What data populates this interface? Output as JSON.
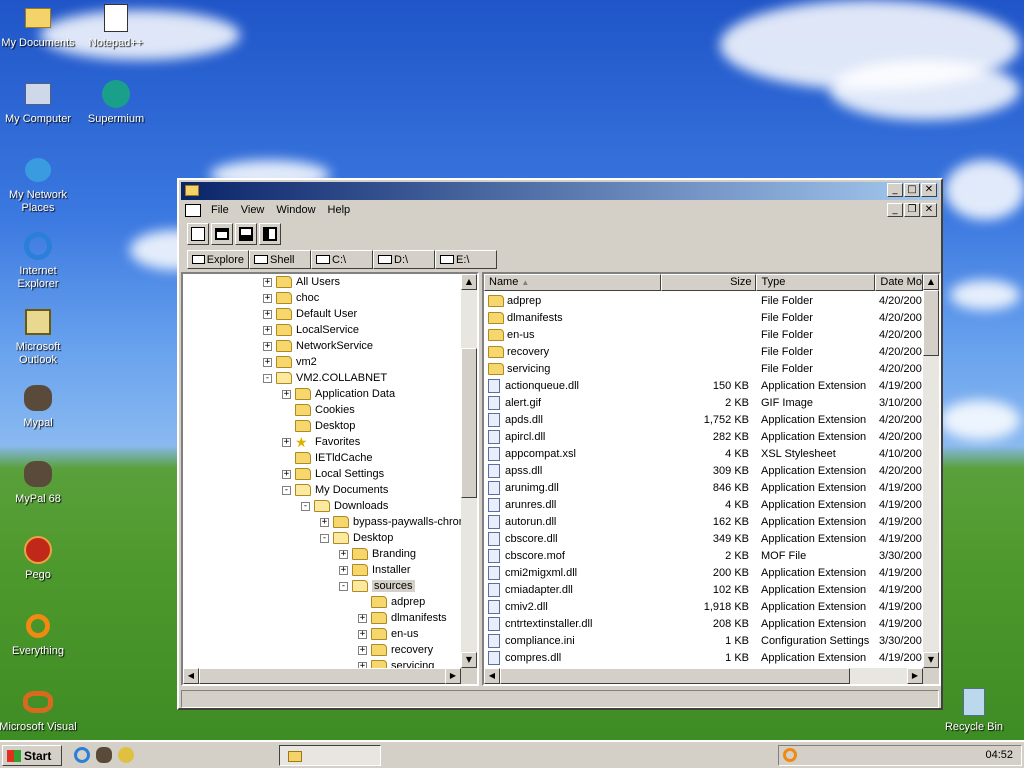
{
  "desktop": {
    "icons": [
      {
        "label": "My Documents"
      },
      {
        "label": "Notepad++"
      },
      {
        "label": "My Computer"
      },
      {
        "label": "Supermium"
      },
      {
        "label": "My Network Places"
      },
      {
        "label": "Internet Explorer"
      },
      {
        "label": "Microsoft Outlook"
      },
      {
        "label": "Mypal"
      },
      {
        "label": "MyPal 68"
      },
      {
        "label": "Pego"
      },
      {
        "label": "Everything"
      },
      {
        "label": "Microsoft Visual"
      },
      {
        "label": "Recycle Bin"
      }
    ]
  },
  "window": {
    "menu": [
      "File",
      "View",
      "Window",
      "Help"
    ],
    "drives": [
      "Explore",
      "Shell",
      "C:\\",
      "D:\\",
      "E:\\"
    ],
    "tree": [
      {
        "label": "All Users",
        "expander": "+"
      },
      {
        "label": "choc",
        "expander": "+"
      },
      {
        "label": "Default User",
        "expander": "+"
      },
      {
        "label": "LocalService",
        "expander": "+"
      },
      {
        "label": "NetworkService",
        "expander": "+"
      },
      {
        "label": "vm2",
        "expander": "+"
      },
      {
        "label": "VM2.COLLABNET",
        "expander": "-"
      },
      {
        "label": "Application Data",
        "expander": "+"
      },
      {
        "label": "Cookies",
        "expander": ""
      },
      {
        "label": "Desktop",
        "expander": ""
      },
      {
        "label": "Favorites",
        "expander": "+"
      },
      {
        "label": "IETldCache",
        "expander": ""
      },
      {
        "label": "Local Settings",
        "expander": "+"
      },
      {
        "label": "My Documents",
        "expander": "-"
      },
      {
        "label": "Downloads",
        "expander": "-"
      },
      {
        "label": "bypass-paywalls-chrom",
        "expander": "+"
      },
      {
        "label": "Desktop",
        "expander": "-"
      },
      {
        "label": "Branding",
        "expander": "+"
      },
      {
        "label": "Installer",
        "expander": "+"
      },
      {
        "label": "sources",
        "expander": "-"
      },
      {
        "label": "adprep",
        "expander": ""
      },
      {
        "label": "dlmanifests",
        "expander": "+"
      },
      {
        "label": "en-us",
        "expander": "+"
      },
      {
        "label": "recovery",
        "expander": "+"
      },
      {
        "label": "servicing",
        "expander": "+"
      }
    ],
    "columns": {
      "name": "Name",
      "size": "Size",
      "type": "Type",
      "date": "Date Mo"
    },
    "files": [
      {
        "name": "adprep",
        "size": "",
        "type": "File Folder",
        "date": "4/20/200",
        "kind": "folder"
      },
      {
        "name": "dlmanifests",
        "size": "",
        "type": "File Folder",
        "date": "4/20/200",
        "kind": "folder"
      },
      {
        "name": "en-us",
        "size": "",
        "type": "File Folder",
        "date": "4/20/200",
        "kind": "folder"
      },
      {
        "name": "recovery",
        "size": "",
        "type": "File Folder",
        "date": "4/20/200",
        "kind": "folder"
      },
      {
        "name": "servicing",
        "size": "",
        "type": "File Folder",
        "date": "4/20/200",
        "kind": "folder"
      },
      {
        "name": "actionqueue.dll",
        "size": "150 KB",
        "type": "Application Extension",
        "date": "4/19/200",
        "kind": "file"
      },
      {
        "name": "alert.gif",
        "size": "2 KB",
        "type": "GIF Image",
        "date": "3/10/200",
        "kind": "file"
      },
      {
        "name": "apds.dll",
        "size": "1,752 KB",
        "type": "Application Extension",
        "date": "4/20/200",
        "kind": "file"
      },
      {
        "name": "apircl.dll",
        "size": "282 KB",
        "type": "Application Extension",
        "date": "4/20/200",
        "kind": "file"
      },
      {
        "name": "appcompat.xsl",
        "size": "4 KB",
        "type": "XSL Stylesheet",
        "date": "4/10/200",
        "kind": "file"
      },
      {
        "name": "apss.dll",
        "size": "309 KB",
        "type": "Application Extension",
        "date": "4/20/200",
        "kind": "file"
      },
      {
        "name": "arunimg.dll",
        "size": "846 KB",
        "type": "Application Extension",
        "date": "4/19/200",
        "kind": "file"
      },
      {
        "name": "arunres.dll",
        "size": "4 KB",
        "type": "Application Extension",
        "date": "4/19/200",
        "kind": "file"
      },
      {
        "name": "autorun.dll",
        "size": "162 KB",
        "type": "Application Extension",
        "date": "4/19/200",
        "kind": "file"
      },
      {
        "name": "cbscore.dll",
        "size": "349 KB",
        "type": "Application Extension",
        "date": "4/19/200",
        "kind": "file"
      },
      {
        "name": "cbscore.mof",
        "size": "2 KB",
        "type": "MOF File",
        "date": "3/30/200",
        "kind": "file"
      },
      {
        "name": "cmi2migxml.dll",
        "size": "200 KB",
        "type": "Application Extension",
        "date": "4/19/200",
        "kind": "file"
      },
      {
        "name": "cmiadapter.dll",
        "size": "102 KB",
        "type": "Application Extension",
        "date": "4/19/200",
        "kind": "file"
      },
      {
        "name": "cmiv2.dll",
        "size": "1,918 KB",
        "type": "Application Extension",
        "date": "4/19/200",
        "kind": "file"
      },
      {
        "name": "cntrtextinstaller.dll",
        "size": "208 KB",
        "type": "Application Extension",
        "date": "4/19/200",
        "kind": "file"
      },
      {
        "name": "compliance.ini",
        "size": "1 KB",
        "type": "Configuration Settings",
        "date": "3/30/200",
        "kind": "file"
      },
      {
        "name": "compres.dll",
        "size": "1 KB",
        "type": "Application Extension",
        "date": "4/19/200",
        "kind": "file"
      }
    ]
  },
  "taskbar": {
    "start_label": "Start",
    "clock": "04:52"
  }
}
